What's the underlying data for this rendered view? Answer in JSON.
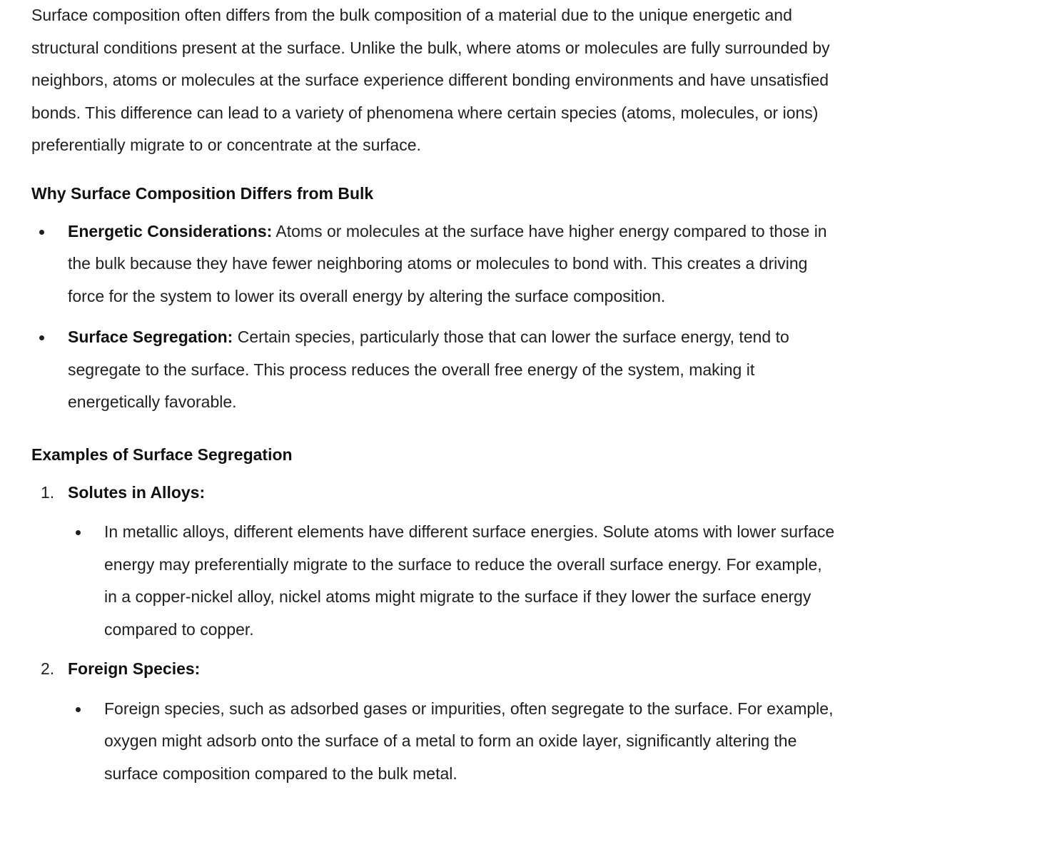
{
  "intro": "Surface composition often differs from the bulk composition of a material due to the unique energetic and structural conditions present at the surface. Unlike the bulk, where atoms or molecules are fully surrounded by neighbors, atoms or molecules at the surface experience different bonding environments and have unsatisfied bonds. This difference can lead to a variety of phenomena where certain species (atoms, molecules, or ions) preferentially migrate to or concentrate at the surface.",
  "why": {
    "heading": "Why Surface Composition Differs from Bulk",
    "items": [
      {
        "label": "Energetic Considerations:",
        "text": " Atoms or molecules at the surface have higher energy compared to those in the bulk because they have fewer neighboring atoms or molecules to bond with. This creates a driving force for the system to lower its overall energy by altering the surface composition."
      },
      {
        "label": "Surface Segregation:",
        "text": " Certain species, particularly those that can lower the surface energy, tend to segregate to the surface. This process reduces the overall free energy of the system, making it energetically favorable."
      }
    ]
  },
  "examples": {
    "heading": "Examples of Surface Segregation",
    "items": [
      {
        "number": "1.",
        "label": "Solutes in Alloys:",
        "sub": "In metallic alloys, different elements have different surface energies. Solute atoms with lower surface energy may preferentially migrate to the surface to reduce the overall surface energy. For example, in a copper-nickel alloy, nickel atoms might migrate to the surface if they lower the surface energy compared to copper."
      },
      {
        "number": "2.",
        "label": "Foreign Species:",
        "sub": "Foreign species, such as adsorbed gases or impurities, often segregate to the surface. For example, oxygen might adsorb onto the surface of a metal to form an oxide layer, significantly altering the surface composition compared to the bulk metal."
      }
    ]
  }
}
